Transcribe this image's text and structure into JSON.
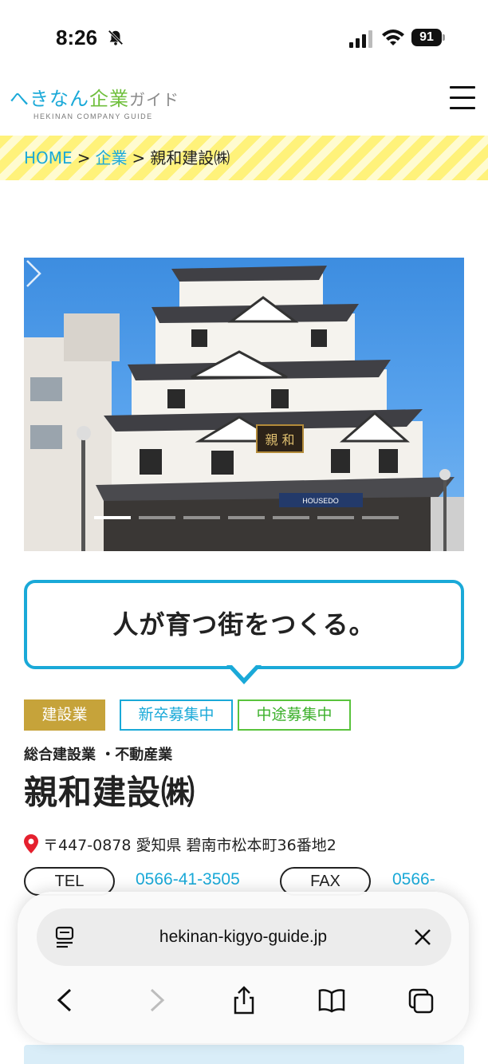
{
  "status_bar": {
    "time": "8:26",
    "battery": "91",
    "icons": [
      "bell-slash-icon",
      "cellular-signal-icon",
      "wifi-icon",
      "battery-icon"
    ]
  },
  "header": {
    "logo_part1": "へきなん",
    "logo_part2": "企業",
    "logo_part3": "ガイド",
    "logo_sub": "HEKINAN COMPANY GUIDE",
    "menu_icon": "hamburger-menu-icon"
  },
  "breadcrumb": {
    "items": [
      "HOME",
      "企業",
      "親和建設㈱"
    ],
    "separator": ">"
  },
  "hero": {
    "slide_count": 7,
    "active_slide": 0,
    "next_icon": "chevron-right-icon",
    "sign_text": "親 和",
    "store_sign": "HOUSEDO"
  },
  "company": {
    "catchphrase": "人が育つ街をつくる。",
    "tags": {
      "industry": "建設業",
      "new_grad": "新卒募集中",
      "mid_career": "中途募集中"
    },
    "category": "総合建設業 ・不動産業",
    "name": "親和建設㈱",
    "address": "〒447-0878 愛知県 碧南市松本町36番地2",
    "tel_label": "TEL",
    "tel": "0566-41-3505",
    "fax_label": "FAX",
    "fax": "0566-"
  },
  "browser": {
    "url": "hekinan-kigyo-guide.jp",
    "forward_enabled": false
  },
  "colors": {
    "accent_blue": "#1aa9d8",
    "accent_green": "#59c33c",
    "industry_gold": "#c6a33a",
    "breadcrumb_yellow": "#fff27a",
    "pin_red": "#e5202e"
  }
}
